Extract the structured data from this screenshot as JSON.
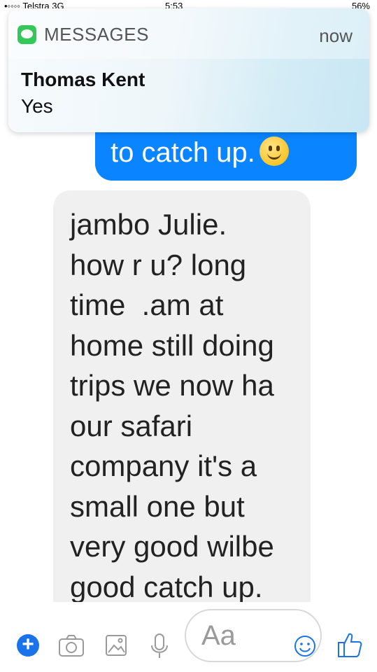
{
  "status_bar": {
    "carrier": "•◦◦◦◦ Telstra 3G",
    "time": "5:53",
    "battery": "56%"
  },
  "notification": {
    "app_name": "MESSAGES",
    "time": "now",
    "sender": "Thomas Kent",
    "message": "Yes"
  },
  "conversation": {
    "outgoing_text": "to catch up.",
    "incoming_lines": [
      "jambo Julie.",
      "how r u? long",
      "time  .am at",
      "home still doing",
      "trips we now ha",
      "our safari",
      "company it's a",
      "small one but",
      "very good wilbe",
      "good catch up."
    ]
  },
  "composer": {
    "placeholder": "Aa",
    "plus_label": "+"
  },
  "icons": [
    "plus-icon",
    "camera-icon",
    "gallery-icon",
    "microphone-icon",
    "emoji-icon",
    "thumbs-up-icon",
    "messages-app-icon"
  ],
  "colors": {
    "outgoing_bubble": "#0a84ff",
    "incoming_bubble": "#f0f0f0",
    "accent": "#1a73e8",
    "messages_app": "#34c759"
  }
}
